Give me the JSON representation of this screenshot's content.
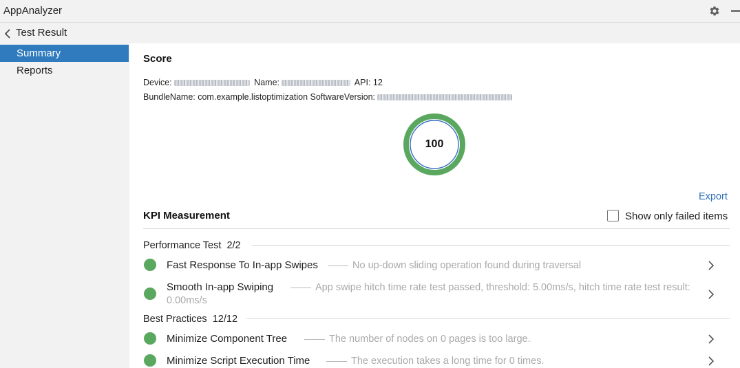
{
  "app": {
    "title": "AppAnalyzer"
  },
  "nav": {
    "title": "Test Result"
  },
  "sidebar": {
    "items": [
      {
        "label": "Summary",
        "active": true
      },
      {
        "label": "Reports",
        "active": false
      }
    ]
  },
  "score": {
    "title": "Score",
    "device_label": "Device:",
    "name_label": "Name:",
    "api_label": "API:",
    "api_value": "12",
    "bundle_label": "BundleName:",
    "bundle_value": "com.example.listoptimization",
    "software_label": "SoftwareVersion:",
    "value": "100"
  },
  "kpi": {
    "export_label": "Export",
    "title": "KPI Measurement",
    "filter_label": "Show only failed items",
    "filter_checked": false
  },
  "sections": [
    {
      "name": "Performance Test",
      "count": "2/2",
      "items": [
        {
          "name": "Fast Response To In-app Swipes",
          "desc": "No up-down sliding operation found during traversal",
          "status": "pass"
        },
        {
          "name": "Smooth In-app Swiping",
          "desc": "App swipe hitch time rate test passed, threshold: 5.00ms/s, hitch time rate test result: 0.00ms/s",
          "status": "pass"
        }
      ]
    },
    {
      "name": "Best Practices",
      "count": "12/12",
      "items": [
        {
          "name": "Minimize Component Tree",
          "desc": "The number of nodes on 0 pages is too large.",
          "status": "pass"
        },
        {
          "name": "Minimize Script Execution Time",
          "desc": "The execution takes a long time for 0 times.",
          "status": "pass"
        }
      ]
    }
  ],
  "colors": {
    "accent": "#2f7bbd",
    "pass": "#5aa85f",
    "link": "#2f6fb5"
  }
}
